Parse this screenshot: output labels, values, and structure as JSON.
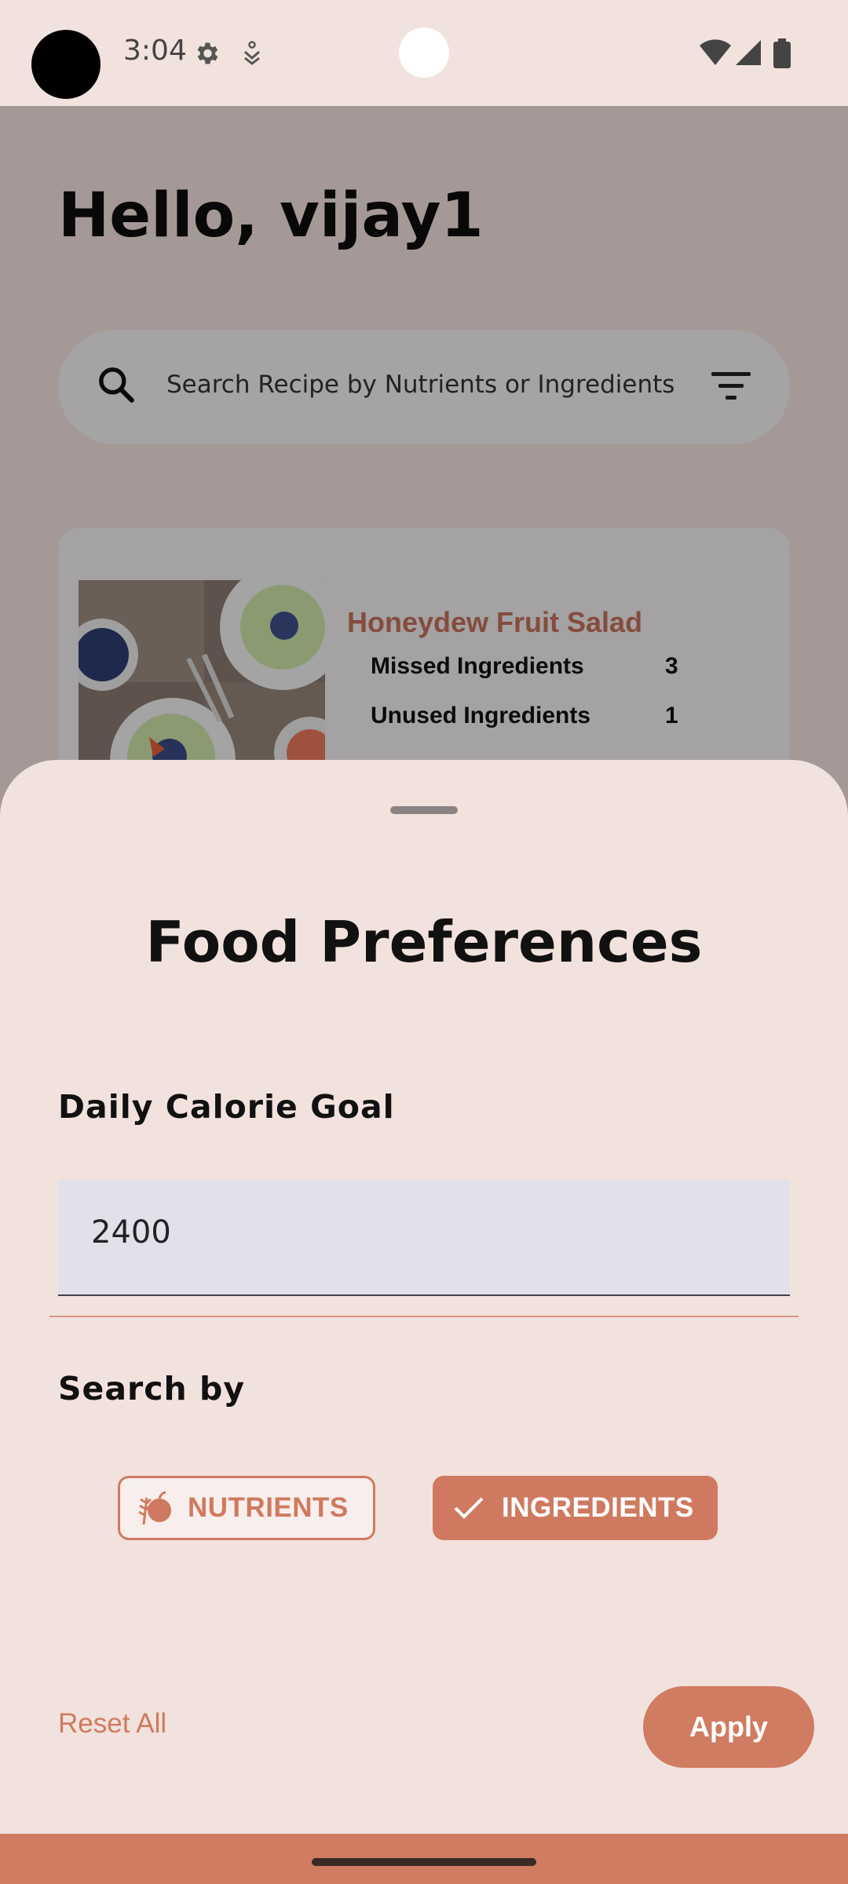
{
  "status_bar": {
    "time": "3:04",
    "icons": [
      "settings-icon",
      "download-icon",
      "wifi-icon",
      "signal-icon",
      "battery-icon"
    ]
  },
  "home": {
    "greeting": "Hello, vijay1",
    "search": {
      "placeholder": "Search Recipe by Nutrients or Ingredients"
    },
    "recipe_card": {
      "title": "Honeydew Fruit Salad",
      "rows": [
        {
          "label": "Missed Ingredients",
          "value": "3"
        },
        {
          "label": "Unused Ingredients",
          "value": "1"
        }
      ]
    }
  },
  "sheet": {
    "title": "Food Preferences",
    "calorie_label": "Daily Calorie Goal",
    "calorie_value": "2400",
    "search_by_label": "Search by",
    "chips": [
      {
        "label": "NUTRIENTS",
        "selected": false,
        "icon": "nutrition-icon"
      },
      {
        "label": "INGREDIENTS",
        "selected": true,
        "icon": "check-icon"
      }
    ],
    "reset_label": "Reset All",
    "apply_label": "Apply"
  },
  "colors": {
    "accent": "#cf7a60",
    "sheet_bg": "#f2e2dd",
    "field_bg": "#e2e0e9"
  }
}
